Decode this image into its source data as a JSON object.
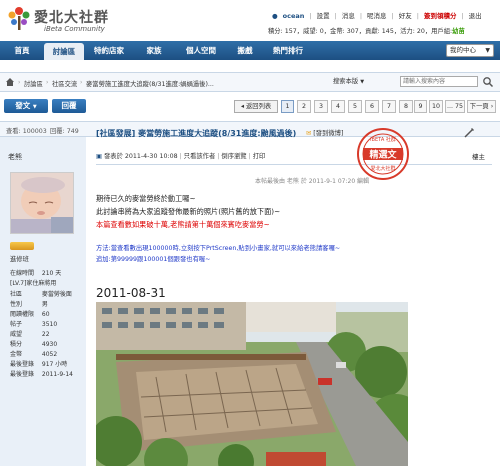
{
  "brand": {
    "title": "愛北大社群",
    "subtitle": "iBeta Community"
  },
  "user_bar": {
    "username": "ocean",
    "items": [
      "設置",
      "消息",
      "呢消息",
      "好友"
    ],
    "checkin": "簽到領積分",
    "logout": "退出"
  },
  "user_stats": {
    "text": "積分: 157，威望: 0，金幣: 307，貢獻: 145，活力: 20，用戶組:",
    "group": "幼苗"
  },
  "nav": {
    "items": [
      "首頁",
      "討論區",
      "特約店家",
      "家族",
      "個人空間",
      "搬戲",
      "熱門排行"
    ],
    "my_center": "我的中心"
  },
  "breadcrumb": {
    "items": [
      "討論區",
      "社區交流",
      "麥當勞施工進度大追蹤(8/31進度:蝸蝸過後)..."
    ],
    "search_type": "搜索本版",
    "search_placeholder": "請輸入搜索內容"
  },
  "actions": {
    "post": "發文",
    "reply": "回覆",
    "prev_list": "返回列表",
    "pages": [
      "1",
      "2",
      "3",
      "4",
      "5",
      "6",
      "7",
      "8",
      "9",
      "10",
      "... 75"
    ],
    "next": "下一頁"
  },
  "thread_info": {
    "views_label": "查看: 100003",
    "replies_label": "回覆: 749"
  },
  "author": {
    "name": "老熊",
    "rank": "進修班",
    "profile": [
      [
        "在線時間",
        "210 天"
      ],
      [
        "[LV.7]家住麻將用",
        ""
      ],
      [
        "社區",
        "麥當勞後面"
      ],
      [
        "性別",
        "男"
      ],
      [
        "閱讀權限",
        "60"
      ],
      [
        "帖子",
        "3510"
      ],
      [
        "威望",
        "22"
      ],
      [
        "積分",
        "4930"
      ],
      [
        "金幣",
        "4052"
      ],
      [
        "最後登錄",
        "917 小時"
      ],
      [
        "最後登錄",
        "2011-9-14"
      ]
    ]
  },
  "post": {
    "title": "[社區發展] 麥當勞施工進度大追蹤(8/31進度:颱風過後)",
    "title_tag": "[發到微博]",
    "meta_posted": "發表於 2011-4-30 10:08",
    "meta_author_only": "只看該作者",
    "meta_reverse": "倒序瀏覽",
    "meta_print": "打印",
    "floor": "樓主",
    "edit_note": "本帖最後由 老熊 於 2011-9-1 07:20 編輯",
    "lines": [
      "期待已久的麥當勞終於動工囉~",
      "此討論串將為大家追蹤發佈最新的照片(照片舊的放下面)~",
      "本篇查看數如果破十萬,老熊請第十萬個來賓吃麥當勞~",
      "方法:當查看數出現100000時,立刻按下PrtScreen,貼到小畫家,就可以來給老熊請客囉~",
      "追加:第99999跟100001個跟發也有喔~"
    ],
    "date_heading": "2011-08-31"
  },
  "stamp": {
    "top": "iBETA 社群",
    "main": "精選文",
    "bottom": "愛北大社群"
  },
  "colors": {
    "nav": "#1d4f82",
    "accent_red": "#cc0000",
    "link_blue": "#1d4f82",
    "sidebar": "#e9f0f8"
  }
}
